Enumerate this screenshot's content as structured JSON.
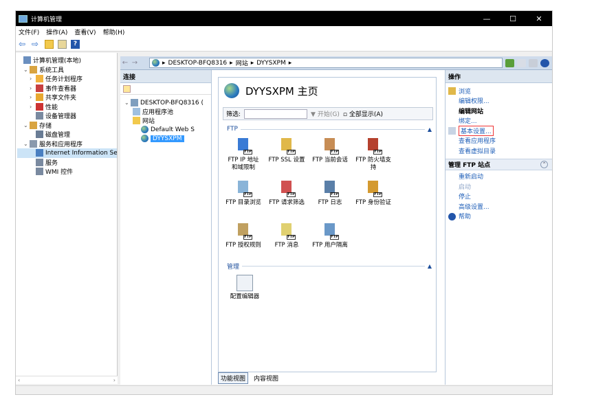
{
  "window": {
    "title": "计算机管理",
    "controls": [
      "—",
      "☐",
      "✕"
    ]
  },
  "menu": [
    "文件(F)",
    "操作(A)",
    "查看(V)",
    "帮助(H)"
  ],
  "tree": {
    "items": [
      {
        "label": "计算机管理(本地)",
        "level": 0,
        "exp": ""
      },
      {
        "label": "系统工具",
        "level": 1,
        "exp": "⌄"
      },
      {
        "label": "任务计划程序",
        "level": 2,
        "exp": "›"
      },
      {
        "label": "事件查看器",
        "level": 2,
        "exp": "›"
      },
      {
        "label": "共享文件夹",
        "level": 2,
        "exp": "›"
      },
      {
        "label": "性能",
        "level": 2,
        "exp": "›"
      },
      {
        "label": "设备管理器",
        "level": 2,
        "exp": ""
      },
      {
        "label": "存储",
        "level": 1,
        "exp": "⌄"
      },
      {
        "label": "磁盘管理",
        "level": 2,
        "exp": ""
      },
      {
        "label": "服务和应用程序",
        "level": 1,
        "exp": "⌄"
      },
      {
        "label": "Internet Information Se",
        "level": 2,
        "exp": ""
      },
      {
        "label": "服务",
        "level": 2,
        "exp": ""
      },
      {
        "label": "WMI 控件",
        "level": 2,
        "exp": ""
      }
    ]
  },
  "iis": {
    "breadcrumb": [
      "DESKTOP-BFQ8316",
      "网站",
      "DYYSXPM"
    ],
    "connections": {
      "header": "连接",
      "nodes": [
        "DESKTOP-BFQ8316 (",
        "应用程序池",
        "网站",
        "Default Web S",
        "DYYSXPM"
      ]
    },
    "center": {
      "title": "DYYSXPM 主页",
      "filter_label": "筛选:",
      "filter_go": "开始(G)",
      "filter_show_all": "全部显示(A)",
      "group_ftp": "FTP",
      "group_manage": "管理",
      "features": [
        "FTP IP 地址\n和域限制",
        "FTP SSL 设置",
        "FTP 当前会话",
        "FTP 防火墙支\n持",
        "FTP 目录浏览",
        "FTP 请求筛选",
        "FTP 日志",
        "FTP 身份验证",
        "FTP 授权规则",
        "FTP 消息",
        "FTP 用户隔离"
      ],
      "manage_features": [
        "配置编辑器"
      ],
      "tab_features": "功能视图",
      "tab_content": "内容视图"
    },
    "actions": {
      "header": "操作",
      "items": [
        {
          "label": "浏览",
          "kind": "link"
        },
        {
          "label": "编辑权限...",
          "kind": "link"
        },
        {
          "label": "编辑网站",
          "kind": "head"
        },
        {
          "label": "绑定...",
          "kind": "link"
        },
        {
          "label": "基本设置...",
          "kind": "link"
        },
        {
          "label": "查看应用程序",
          "kind": "link"
        },
        {
          "label": "查看虚拟目录",
          "kind": "link"
        }
      ],
      "manage_header": "管理 FTP 站点",
      "manage_items": [
        {
          "label": "重新启动",
          "kind": "link"
        },
        {
          "label": "启动",
          "kind": "disabled"
        },
        {
          "label": "停止",
          "kind": "link"
        },
        {
          "label": "高级设置...",
          "kind": "link"
        },
        {
          "label": "帮助",
          "kind": "link"
        }
      ]
    }
  },
  "colors": {
    "accent": "#3399ff",
    "link": "#1f5fb8",
    "highlight_box": "#ee3333"
  }
}
